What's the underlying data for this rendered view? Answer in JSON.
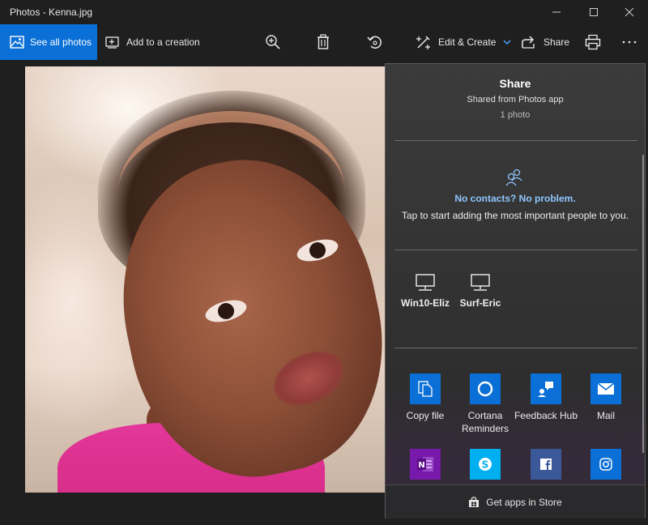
{
  "window": {
    "title": "Photos - Kenna.jpg"
  },
  "toolbar": {
    "see_all_label": "See all photos",
    "add_creation_label": "Add to a creation",
    "edit_create_label": "Edit & Create",
    "share_label": "Share"
  },
  "share_panel": {
    "title": "Share",
    "subtitle": "Shared from Photos app",
    "count": "1 photo",
    "no_contacts": "No contacts? No problem.",
    "tap_text": "Tap to start adding the most important people to you.",
    "devices": [
      {
        "label": "Win10-Eliz"
      },
      {
        "label": "Surf-Eric"
      }
    ],
    "apps": [
      {
        "label": "Copy file",
        "color": "#0a6fd6"
      },
      {
        "label": "Cortana Reminders",
        "color": "#0a6fd6"
      },
      {
        "label": "Feedback Hub",
        "color": "#0a6fd6"
      },
      {
        "label": "Mail",
        "color": "#0a6fd6"
      },
      {
        "label": "",
        "color": "#7719aa"
      },
      {
        "label": "",
        "color": "#00aff0"
      },
      {
        "label": "",
        "color": "#3b5998"
      },
      {
        "label": "",
        "color": "#0a6fd6"
      }
    ],
    "store_label": "Get apps in Store"
  },
  "colors": {
    "accent": "#0a6fd6",
    "link": "#8ec6ff",
    "background": "#1f1f1f"
  }
}
